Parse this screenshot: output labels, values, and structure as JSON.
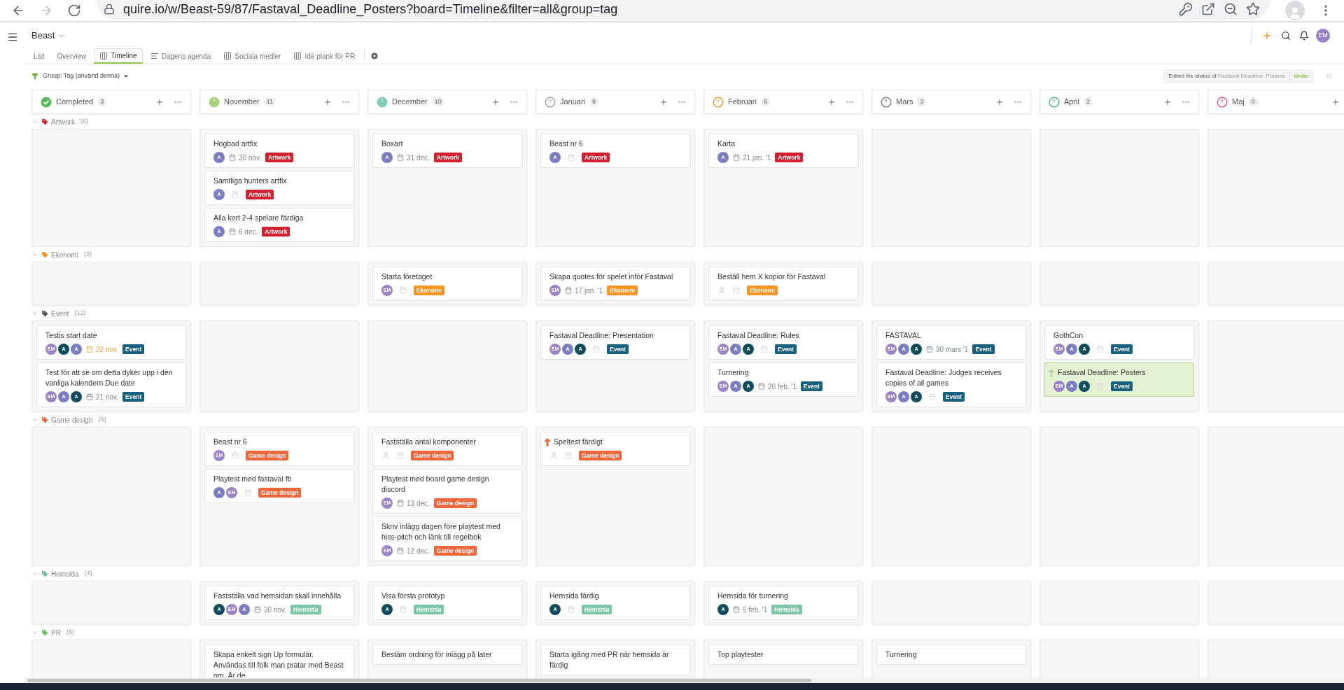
{
  "browser": {
    "url": "quire.io/w/Beast-59/87/Fastaval_Deadline_Posters?board=Timeline&filter=all&group=tag"
  },
  "project": {
    "name": "Beast"
  },
  "tabs": [
    {
      "label": "List",
      "kind": "plain",
      "selected": false
    },
    {
      "label": "Overview",
      "kind": "plain",
      "selected": false
    },
    {
      "label": "Timeline",
      "kind": "board",
      "selected": true
    },
    {
      "label": "Dagens agenda",
      "kind": "list",
      "selected": false
    },
    {
      "label": "Sociala medier",
      "kind": "board",
      "selected": false
    },
    {
      "label": "Idé plank för PR",
      "kind": "board",
      "selected": false
    }
  ],
  "user": {
    "initials": "EM"
  },
  "group_by": {
    "label": "Group: Tag (använd denna)"
  },
  "toast": {
    "prefix": "Edited the status of",
    "task": "Fastaval Deadline: Posters",
    "action": "Undo"
  },
  "columns": [
    {
      "name": "Completed",
      "count": "3",
      "kind": "done",
      "color": "#5cb85c"
    },
    {
      "name": "November",
      "count": "11",
      "kind": "partial",
      "color": "#a8d07a"
    },
    {
      "name": "December",
      "count": "10",
      "kind": "partial",
      "color": "#7fcbb8"
    },
    {
      "name": "Januari",
      "count": "9",
      "kind": "open",
      "color": "#9a9a9a"
    },
    {
      "name": "Februari",
      "count": "6",
      "kind": "open",
      "color": "#f7931e"
    },
    {
      "name": "Mars",
      "count": "3",
      "kind": "open",
      "color": "#777777"
    },
    {
      "name": "April",
      "count": "2",
      "kind": "open",
      "color": "#3cb878"
    },
    {
      "name": "Maj",
      "count": "0",
      "kind": "open",
      "color": "#e8467c"
    }
  ],
  "groups": [
    {
      "name": "Artwork",
      "count": "(6)",
      "color": "#d9252f",
      "expanded": true,
      "cells": [
        [],
        [
          {
            "title": "Hogbad artfix",
            "assignees": [
              {
                "initials": "A",
                "color": "#7a7fc4"
              }
            ],
            "date": {
              "text": "30 nov.",
              "overdue": false
            },
            "tag": {
              "label": "Artwork",
              "color": "#d32030"
            },
            "selected": false
          },
          {
            "title": "Samtliga hunters artfix",
            "assignees": [
              {
                "initials": "A",
                "color": "#7a7fc4"
              }
            ],
            "tag": {
              "label": "Artwork",
              "color": "#d32030"
            },
            "selected": false
          },
          {
            "title": "Alla kort 2-4 spelare färdiga",
            "assignees": [
              {
                "initials": "A",
                "color": "#7a7fc4"
              }
            ],
            "date": {
              "text": "6 dec.",
              "overdue": false
            },
            "tag": {
              "label": "Artwork",
              "color": "#d32030"
            },
            "selected": false
          }
        ],
        [
          {
            "title": "Boxart",
            "assignees": [
              {
                "initials": "A",
                "color": "#7a7fc4"
              }
            ],
            "date": {
              "text": "31 dec.",
              "overdue": false
            },
            "tag": {
              "label": "Artwork",
              "color": "#d32030"
            },
            "selected": false
          }
        ],
        [
          {
            "title": "Beast nr 6",
            "assignees": [
              {
                "initials": "A",
                "color": "#7a7fc4"
              }
            ],
            "tag": {
              "label": "Artwork",
              "color": "#d32030"
            },
            "selected": false
          }
        ],
        [
          {
            "title": "Karta",
            "assignees": [
              {
                "initials": "A",
                "color": "#7a7fc4"
              }
            ],
            "date": {
              "text": "21 jan. '1",
              "overdue": false
            },
            "tag": {
              "label": "Artwork",
              "color": "#d32030"
            },
            "selected": false
          }
        ],
        [],
        [],
        []
      ]
    },
    {
      "name": "Ekonomi",
      "count": "(3)",
      "color": "#f7931e",
      "expanded": true,
      "cells": [
        [],
        [],
        [
          {
            "title": "Starta företaget",
            "assignees": [
              {
                "initials": "EM",
                "color": "#9a83c4"
              }
            ],
            "tag": {
              "label": "Ekonomi",
              "color": "#f7931e"
            },
            "selected": false
          }
        ],
        [
          {
            "title": "Skapa quotes för spelet inför Fastaval",
            "assignees": [
              {
                "initials": "EM",
                "color": "#9a83c4"
              }
            ],
            "date": {
              "text": "17 jan. '1",
              "overdue": false
            },
            "tag": {
              "label": "Ekonomi",
              "color": "#f7931e"
            },
            "selected": false
          }
        ],
        [
          {
            "title": "Beställ hem X kopior för Fastaval",
            "tag": {
              "label": "Ekonomi",
              "color": "#f7931e"
            },
            "selected": false
          }
        ],
        [],
        [],
        []
      ]
    },
    {
      "name": "Event",
      "count": "(12)",
      "color": "#555555",
      "expanded": true,
      "cells": [
        [
          {
            "title": "Testis start date",
            "assignees": [
              {
                "initials": "EM",
                "color": "#9a83c4"
              },
              {
                "initials": "A",
                "color": "#0f4c5c"
              },
              {
                "initials": "A",
                "color": "#7a7fc4"
              }
            ],
            "date": {
              "text": "22 nov.",
              "overdue": true
            },
            "tag": {
              "label": "Event",
              "color": "#17607d"
            },
            "selected": false
          },
          {
            "title": "Test för att se om detta dyker upp i den vanliga kalendern Due date",
            "assignees": [
              {
                "initials": "EM",
                "color": "#9a83c4"
              },
              {
                "initials": "A",
                "color": "#7a7fc4"
              },
              {
                "initials": "A",
                "color": "#0f4c5c"
              }
            ],
            "date": {
              "text": "21 nov.",
              "overdue": false
            },
            "tag": {
              "label": "Event",
              "color": "#17607d"
            },
            "selected": false
          }
        ],
        [],
        [],
        [
          {
            "title": "Fastaval Deadline: Presentation",
            "assignees": [
              {
                "initials": "EM",
                "color": "#9a83c4"
              },
              {
                "initials": "A",
                "color": "#7a7fc4"
              },
              {
                "initials": "A",
                "color": "#0f4c5c"
              }
            ],
            "tag": {
              "label": "Event",
              "color": "#17607d"
            },
            "selected": false
          }
        ],
        [
          {
            "title": "Fastaval Deadline: Rules",
            "assignees": [
              {
                "initials": "EM",
                "color": "#9a83c4"
              },
              {
                "initials": "A",
                "color": "#7a7fc4"
              },
              {
                "initials": "A",
                "color": "#0f4c5c"
              }
            ],
            "tag": {
              "label": "Event",
              "color": "#17607d"
            },
            "selected": false
          },
          {
            "title": "Turnering",
            "assignees": [
              {
                "initials": "EM",
                "color": "#9a83c4"
              },
              {
                "initials": "A",
                "color": "#7a7fc4"
              },
              {
                "initials": "A",
                "color": "#0f4c5c"
              }
            ],
            "date": {
              "text": "20 feb. '1",
              "overdue": false
            },
            "tag": {
              "label": "Event",
              "color": "#17607d"
            },
            "selected": false
          }
        ],
        [
          {
            "title": "FASTAVAL",
            "assignees": [
              {
                "initials": "EM",
                "color": "#9a83c4"
              },
              {
                "initials": "A",
                "color": "#7a7fc4"
              },
              {
                "initials": "A",
                "color": "#0f4c5c"
              }
            ],
            "date": {
              "text": "30 mars '1",
              "overdue": false
            },
            "tag": {
              "label": "Event",
              "color": "#17607d"
            },
            "selected": false
          },
          {
            "title": "Fastaval Deadline: Judges receives copies of all games",
            "assignees": [
              {
                "initials": "EM",
                "color": "#9a83c4"
              },
              {
                "initials": "A",
                "color": "#7a7fc4"
              },
              {
                "initials": "A",
                "color": "#0f4c5c"
              }
            ],
            "tag": {
              "label": "Event",
              "color": "#17607d"
            },
            "selected": false
          }
        ],
        [
          {
            "title": "GothCon",
            "assignees": [
              {
                "initials": "EM",
                "color": "#9a83c4"
              },
              {
                "initials": "A",
                "color": "#7a7fc4"
              },
              {
                "initials": "A",
                "color": "#0f4c5c"
              }
            ],
            "tag": {
              "label": "Event",
              "color": "#17607d"
            },
            "selected": false
          },
          {
            "title": "Fastaval Deadline: Posters",
            "priority": {
              "color": "#b7d49a"
            },
            "assignees": [
              {
                "initials": "EM",
                "color": "#9a83c4"
              },
              {
                "initials": "A",
                "color": "#7a7fc4"
              },
              {
                "initials": "A",
                "color": "#0f4c5c"
              }
            ],
            "tag": {
              "label": "Event",
              "color": "#17607d"
            },
            "selected": true
          }
        ],
        []
      ]
    },
    {
      "name": "Game design",
      "count": "(6)",
      "color": "#f2643a",
      "expanded": true,
      "cells": [
        [],
        [
          {
            "title": "Beast nr 6",
            "assignees": [
              {
                "initials": "EM",
                "color": "#9a83c4"
              }
            ],
            "tag": {
              "label": "Game design",
              "color": "#f2643a"
            },
            "selected": false
          },
          {
            "title": "Playtest med fastaval fb",
            "assignees": [
              {
                "initials": "A",
                "color": "#7a7fc4"
              },
              {
                "initials": "EM",
                "color": "#9a83c4"
              }
            ],
            "tag": {
              "label": "Game design",
              "color": "#f2643a"
            },
            "selected": false
          }
        ],
        [
          {
            "title": "Fastställa antal komponenter",
            "tag": {
              "label": "Game design",
              "color": "#f2643a"
            },
            "selected": false
          },
          {
            "title": "Playtest med board game design discord",
            "assignees": [
              {
                "initials": "EM",
                "color": "#9a83c4"
              }
            ],
            "date": {
              "text": "13 dec.",
              "overdue": false
            },
            "tag": {
              "label": "Game design",
              "color": "#f2643a"
            },
            "selected": false
          },
          {
            "title": "Skriv inlägg dagen före playtest med hiss-pitch och länk till regelbok",
            "assignees": [
              {
                "initials": "EM",
                "color": "#9a83c4"
              }
            ],
            "date": {
              "text": "12 dec.",
              "overdue": false
            },
            "tag": {
              "label": "Game design",
              "color": "#f2643a"
            },
            "selected": false
          }
        ],
        [
          {
            "title": "Speltest färdigt",
            "priority": {
              "color": "#f2643a"
            },
            "tag": {
              "label": "Game design",
              "color": "#f2643a"
            },
            "selected": false
          }
        ],
        [],
        [],
        [],
        []
      ]
    },
    {
      "name": "Hemsida",
      "count": "(4)",
      "color": "#6cbf9a",
      "expanded": true,
      "cells": [
        [],
        [
          {
            "title": "Fastställa vad hemsidan skall innehålla",
            "assignees": [
              {
                "initials": "A",
                "color": "#0f4c5c"
              },
              {
                "initials": "EM",
                "color": "#9a83c4"
              },
              {
                "initials": "A",
                "color": "#7a7fc4"
              }
            ],
            "date": {
              "text": "30 nov.",
              "overdue": false
            },
            "tag": {
              "label": "Hemsida",
              "color": "#7cc6a6"
            },
            "selected": false
          }
        ],
        [
          {
            "title": "Visa första prototyp",
            "assignees": [
              {
                "initials": "A",
                "color": "#0f4c5c"
              }
            ],
            "tag": {
              "label": "Hemsida",
              "color": "#7cc6a6"
            },
            "selected": false
          }
        ],
        [
          {
            "title": "Hemsida färdig",
            "assignees": [
              {
                "initials": "A",
                "color": "#0f4c5c"
              }
            ],
            "tag": {
              "label": "Hemsida",
              "color": "#7cc6a6"
            },
            "selected": false
          }
        ],
        [
          {
            "title": "Hemsida för turnering",
            "assignees": [
              {
                "initials": "A",
                "color": "#0f4c5c"
              }
            ],
            "date": {
              "text": "5 feb. '1",
              "overdue": false
            },
            "tag": {
              "label": "Hemsida",
              "color": "#7cc6a6"
            },
            "selected": false
          }
        ],
        [],
        [],
        []
      ]
    },
    {
      "name": "PR",
      "count": "(6)",
      "color": "#6cbf6c",
      "expanded": true,
      "cells": [
        [],
        [
          {
            "title": "Skapa enkelt sign Up formulär. Användas till folk man pratar med Beast om. Är de",
            "selected": false
          }
        ],
        [
          {
            "title": "Bestäm ordning för inlägg på later",
            "selected": false
          }
        ],
        [
          {
            "title": "Starta igång med PR när hemsida är färdig",
            "selected": false
          }
        ],
        [
          {
            "title": "Top playtester",
            "selected": false
          }
        ],
        [
          {
            "title": "Turnering",
            "selected": false
          }
        ],
        [],
        []
      ]
    }
  ]
}
